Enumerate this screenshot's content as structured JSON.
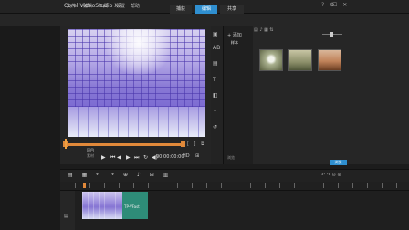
{
  "app": {
    "title": "Corel VideoStudio X7"
  },
  "steps": [
    "捕获",
    "编辑",
    "共享"
  ],
  "window_controls": "— ☐ ✕",
  "menu": [
    "文件",
    "编辑",
    "工具",
    "设置",
    "帮助"
  ],
  "help_icons": "? ⚙",
  "scale_label": "▣",
  "preview": {
    "project_label": "项目",
    "clip_label": "素材",
    "play_icon": "▶",
    "home_icon": "⏮",
    "prev_icon": "◀",
    "next_icon": "▶",
    "end_icon": "⏭",
    "loop_icon": "↻",
    "vol_icon": "◀)",
    "timecode": "00:00:00:00",
    "hd_label": "HD",
    "snap_label": "⊞",
    "trim_marks": "[ ] ⧉"
  },
  "library": {
    "tool_icons": [
      "▣",
      "AB",
      "▤",
      "T",
      "◧",
      "✦",
      "↺"
    ],
    "add_label": "+ 添加",
    "folders": [
      "样本",
      "",
      ""
    ],
    "browse_folder": "浏览",
    "toolbar": "▤ ♪ ▦  ⇅",
    "thumbs": [
      {
        "caption": ""
      },
      {
        "caption": ""
      },
      {
        "caption": ""
      }
    ],
    "browse_button": "浏览"
  },
  "timeline": {
    "tools": "▤ ▦ ↶ ↷ ⊕ ♪ ⊞ ▥",
    "right_tools": "↶ ↷ ⊖ ⊕",
    "track_icon": "▤",
    "clip_text": "TP-VFast"
  }
}
